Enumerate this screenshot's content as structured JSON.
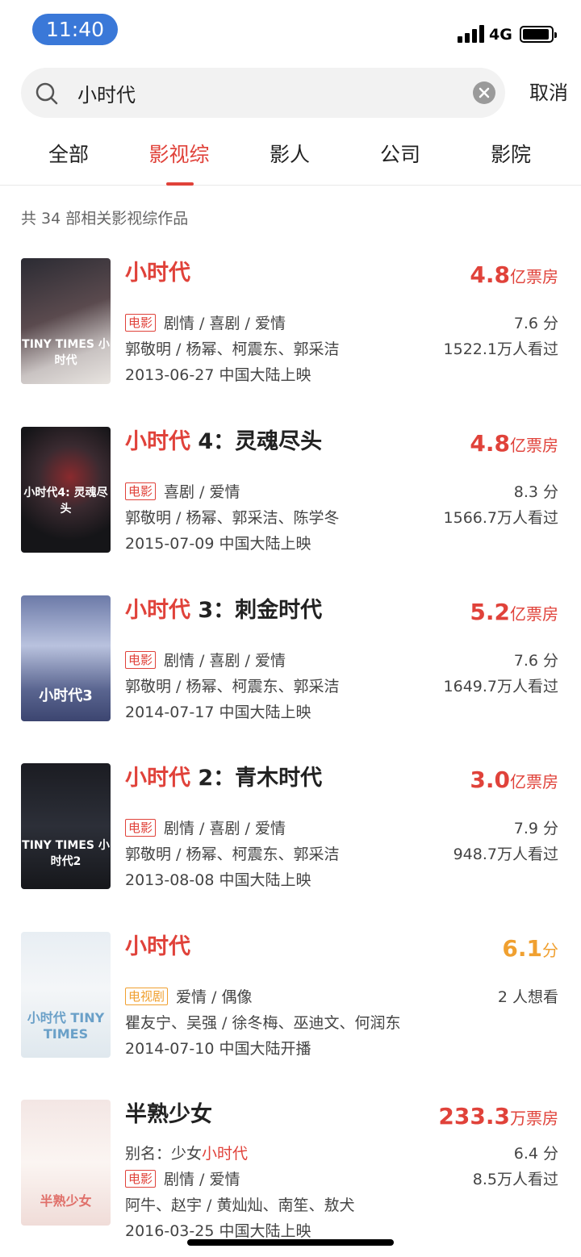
{
  "status": {
    "time": "11:40",
    "network": "4G"
  },
  "search": {
    "query": "小时代",
    "cancel": "取消"
  },
  "tabs": [
    "全部",
    "影视综",
    "影人",
    "公司",
    "影院"
  ],
  "summary": "共 34 部相关影视综作品",
  "colors": {
    "accent": "#e0423a",
    "tv_tag": "#f0a030",
    "time_pill": "#3a78d8"
  },
  "results": [
    {
      "title_hl": "小时代",
      "title_rest": "",
      "box_value": "4.8",
      "box_unit": "亿票房",
      "tag": "电影",
      "genres": "剧情 / 喜剧 / 爱情",
      "score": "7.6 分",
      "cast": "郭敬明 / 杨幂、柯震东、郭采洁",
      "viewers": "1522.1万人看过",
      "release": "2013-06-27 中国大陆上映",
      "poster_text": "TINY TIMES 小时代"
    },
    {
      "title_hl": "小时代",
      "title_rest": " 4：灵魂尽头",
      "box_value": "4.8",
      "box_unit": "亿票房",
      "tag": "电影",
      "genres": "喜剧 / 爱情",
      "score": "8.3 分",
      "cast": "郭敬明 / 杨幂、郭采洁、陈学冬",
      "viewers": "1566.7万人看过",
      "release": "2015-07-09 中国大陆上映",
      "poster_text": "小时代4: 灵魂尽头"
    },
    {
      "title_hl": "小时代",
      "title_rest": " 3：刺金时代",
      "box_value": "5.2",
      "box_unit": "亿票房",
      "tag": "电影",
      "genres": "剧情 / 喜剧 / 爱情",
      "score": "7.6 分",
      "cast": "郭敬明 / 杨幂、柯震东、郭采洁",
      "viewers": "1649.7万人看过",
      "release": "2014-07-17 中国大陆上映",
      "poster_text": "小时代3"
    },
    {
      "title_hl": "小时代",
      "title_rest": " 2：青木时代",
      "box_value": "3.0",
      "box_unit": "亿票房",
      "tag": "电影",
      "genres": "剧情 / 喜剧 / 爱情",
      "score": "7.9 分",
      "cast": "郭敬明 / 杨幂、柯震东、郭采洁",
      "viewers": "948.7万人看过",
      "release": "2013-08-08 中国大陆上映",
      "poster_text": "TINY TIMES 小时代2"
    },
    {
      "title_hl": "小时代",
      "title_rest": "",
      "box_value": "6.1",
      "box_unit": "分",
      "tag": "电视剧",
      "genres": "爱情 / 偶像",
      "score": "2 人想看",
      "cast": "瞿友宁、吴强 / 徐冬梅、巫迪文、何润东",
      "viewers": "",
      "release": "2014-07-10 中国大陆开播",
      "poster_text": "小时代 TINY TIMES"
    },
    {
      "title_hl": "",
      "title_rest": "半熟少女",
      "box_value": "233.3",
      "box_unit": "万票房",
      "alias_label": "别名：少女",
      "alias_hl": "小时代",
      "alias_score": "6.4 分",
      "tag": "电影",
      "genres": "剧情 / 爱情",
      "score": "8.5万人看过",
      "cast": "阿牛、赵宇 / 黄灿灿、南笙、敖犬",
      "viewers": "",
      "release": "2016-03-25 中国大陆上映",
      "poster_text": "半熟少女"
    }
  ]
}
